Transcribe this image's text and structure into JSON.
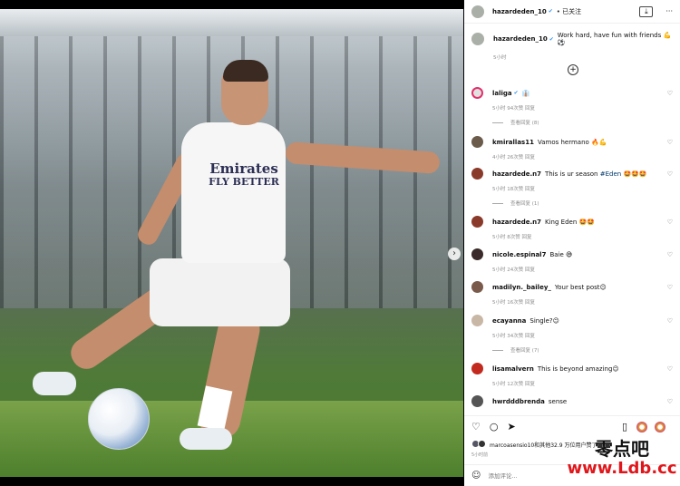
{
  "post": {
    "username": "hazardeden_10",
    "verified": "✔",
    "follow_label": "• 已关注",
    "caption": "Work hard, have fun with friends 💪⚽",
    "caption_time": "5小时",
    "jersey_line1": "Emirates",
    "jersey_line2": "FLY BETTER"
  },
  "comments": [
    {
      "user": "laliga",
      "verified": "✔",
      "text": "👔",
      "meta": "5小时  94次赞  回复",
      "replies": "查看回复 (8)",
      "avatar_color": "#e0e0e0"
    },
    {
      "user": "kmirallas11",
      "text": "Vamos hermano 🔥💪",
      "meta": "4小时  26次赞  回复",
      "avatar_color": "#6b5b4a"
    },
    {
      "user": "hazardede.n7",
      "text": "This is ur season ",
      "mention": "#Eden",
      "text2": " 🤩🤩🤩",
      "meta": "5小时  18次赞  回复",
      "replies": "查看回复 (1)",
      "avatar_color": "#8a3a2a"
    },
    {
      "user": "hazardede.n7",
      "text": "King Eden 🤩🤩",
      "meta": "5小时  8次赞  回复",
      "avatar_color": "#8a3a2a"
    },
    {
      "user": "nicole.espinal7",
      "text": "Baie 😅",
      "meta": "5小时  24次赞  回复",
      "avatar_color": "#3a2a2a"
    },
    {
      "user": "madilyn._bailey_",
      "text": "Your best post😉",
      "meta": "5小时  16次赞  回复",
      "avatar_color": "#7a5a4a"
    },
    {
      "user": "ecayanna",
      "text": "Single?😉",
      "meta": "5小时  34次赞  回复",
      "replies": "查看回复 (7)",
      "avatar_color": "#c9b7a6"
    },
    {
      "user": "lisamalvern",
      "text": "This is beyond amazing😉",
      "meta": "5小时  12次赞  回复",
      "avatar_color": "#c22a1f"
    },
    {
      "user": "hwrdddbrenda",
      "text": "sense",
      "meta": "",
      "avatar_color": "#555"
    }
  ],
  "likes_text": "marcoasensio10和其他32.9 万位用户赞了",
  "post_time": "5小时前",
  "comment_placeholder": "添加评论...",
  "watermark": {
    "cn": "零点吧",
    "url": "www.Ldb.cc"
  }
}
